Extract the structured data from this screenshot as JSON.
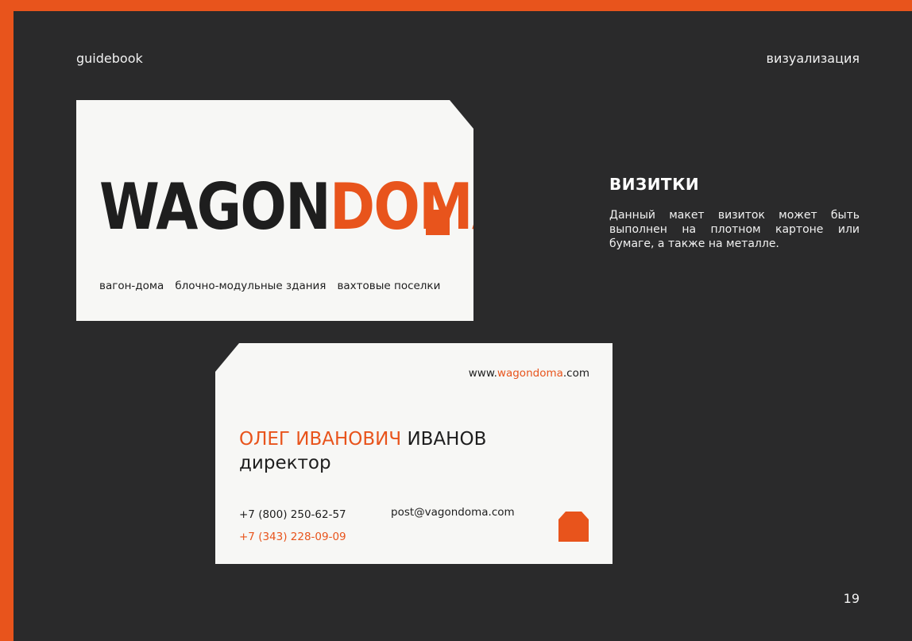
{
  "header": {
    "left_label": "guidebook",
    "right_label": "визуализация"
  },
  "section": {
    "title": "ВИЗИТКИ",
    "description": "Данный макет визиток может быть выполнен на плотном картоне или бумаге, а также на металле."
  },
  "front_card": {
    "logo_part1": "WAGON",
    "logo_part2": "DOMA",
    "tagline": [
      "вагон-дома",
      "блочно-модульные здания",
      "вахтовые поселки"
    ]
  },
  "back_card": {
    "website_prefix": "www.",
    "website_accent": "wagondoma",
    "website_suffix": ".com",
    "first_name": "ОЛЕГ ИВАНОВИЧ",
    "last_name": "ИВАНОВ",
    "role": "директор",
    "phone_primary": "+7 (800) 250-62-57",
    "phone_secondary": "+7 (343) 228-09-09",
    "email": "post@vagondoma.com"
  },
  "footer": {
    "page_number": "19"
  },
  "colors": {
    "accent": "#e8541c",
    "background": "#2a2a2b",
    "card": "#f7f7f5",
    "text_dark": "#1e1e1e"
  }
}
